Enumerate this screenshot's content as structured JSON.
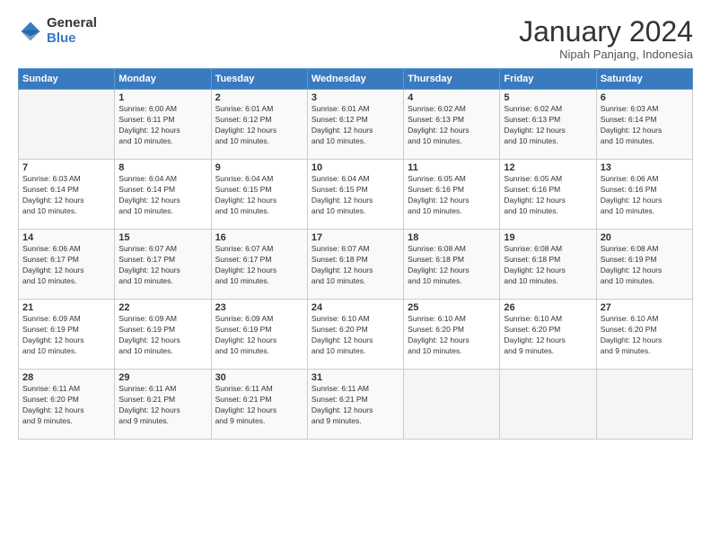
{
  "logo": {
    "general": "General",
    "blue": "Blue"
  },
  "header": {
    "month_year": "January 2024",
    "location": "Nipah Panjang, Indonesia"
  },
  "weekdays": [
    "Sunday",
    "Monday",
    "Tuesday",
    "Wednesday",
    "Thursday",
    "Friday",
    "Saturday"
  ],
  "weeks": [
    [
      {
        "day": "",
        "info": ""
      },
      {
        "day": "1",
        "info": "Sunrise: 6:00 AM\nSunset: 6:11 PM\nDaylight: 12 hours\nand 10 minutes."
      },
      {
        "day": "2",
        "info": "Sunrise: 6:01 AM\nSunset: 6:12 PM\nDaylight: 12 hours\nand 10 minutes."
      },
      {
        "day": "3",
        "info": "Sunrise: 6:01 AM\nSunset: 6:12 PM\nDaylight: 12 hours\nand 10 minutes."
      },
      {
        "day": "4",
        "info": "Sunrise: 6:02 AM\nSunset: 6:13 PM\nDaylight: 12 hours\nand 10 minutes."
      },
      {
        "day": "5",
        "info": "Sunrise: 6:02 AM\nSunset: 6:13 PM\nDaylight: 12 hours\nand 10 minutes."
      },
      {
        "day": "6",
        "info": "Sunrise: 6:03 AM\nSunset: 6:14 PM\nDaylight: 12 hours\nand 10 minutes."
      }
    ],
    [
      {
        "day": "7",
        "info": "Sunrise: 6:03 AM\nSunset: 6:14 PM\nDaylight: 12 hours\nand 10 minutes."
      },
      {
        "day": "8",
        "info": "Sunrise: 6:04 AM\nSunset: 6:14 PM\nDaylight: 12 hours\nand 10 minutes."
      },
      {
        "day": "9",
        "info": "Sunrise: 6:04 AM\nSunset: 6:15 PM\nDaylight: 12 hours\nand 10 minutes."
      },
      {
        "day": "10",
        "info": "Sunrise: 6:04 AM\nSunset: 6:15 PM\nDaylight: 12 hours\nand 10 minutes."
      },
      {
        "day": "11",
        "info": "Sunrise: 6:05 AM\nSunset: 6:16 PM\nDaylight: 12 hours\nand 10 minutes."
      },
      {
        "day": "12",
        "info": "Sunrise: 6:05 AM\nSunset: 6:16 PM\nDaylight: 12 hours\nand 10 minutes."
      },
      {
        "day": "13",
        "info": "Sunrise: 6:06 AM\nSunset: 6:16 PM\nDaylight: 12 hours\nand 10 minutes."
      }
    ],
    [
      {
        "day": "14",
        "info": "Sunrise: 6:06 AM\nSunset: 6:17 PM\nDaylight: 12 hours\nand 10 minutes."
      },
      {
        "day": "15",
        "info": "Sunrise: 6:07 AM\nSunset: 6:17 PM\nDaylight: 12 hours\nand 10 minutes."
      },
      {
        "day": "16",
        "info": "Sunrise: 6:07 AM\nSunset: 6:17 PM\nDaylight: 12 hours\nand 10 minutes."
      },
      {
        "day": "17",
        "info": "Sunrise: 6:07 AM\nSunset: 6:18 PM\nDaylight: 12 hours\nand 10 minutes."
      },
      {
        "day": "18",
        "info": "Sunrise: 6:08 AM\nSunset: 6:18 PM\nDaylight: 12 hours\nand 10 minutes."
      },
      {
        "day": "19",
        "info": "Sunrise: 6:08 AM\nSunset: 6:18 PM\nDaylight: 12 hours\nand 10 minutes."
      },
      {
        "day": "20",
        "info": "Sunrise: 6:08 AM\nSunset: 6:19 PM\nDaylight: 12 hours\nand 10 minutes."
      }
    ],
    [
      {
        "day": "21",
        "info": "Sunrise: 6:09 AM\nSunset: 6:19 PM\nDaylight: 12 hours\nand 10 minutes."
      },
      {
        "day": "22",
        "info": "Sunrise: 6:09 AM\nSunset: 6:19 PM\nDaylight: 12 hours\nand 10 minutes."
      },
      {
        "day": "23",
        "info": "Sunrise: 6:09 AM\nSunset: 6:19 PM\nDaylight: 12 hours\nand 10 minutes."
      },
      {
        "day": "24",
        "info": "Sunrise: 6:10 AM\nSunset: 6:20 PM\nDaylight: 12 hours\nand 10 minutes."
      },
      {
        "day": "25",
        "info": "Sunrise: 6:10 AM\nSunset: 6:20 PM\nDaylight: 12 hours\nand 10 minutes."
      },
      {
        "day": "26",
        "info": "Sunrise: 6:10 AM\nSunset: 6:20 PM\nDaylight: 12 hours\nand 9 minutes."
      },
      {
        "day": "27",
        "info": "Sunrise: 6:10 AM\nSunset: 6:20 PM\nDaylight: 12 hours\nand 9 minutes."
      }
    ],
    [
      {
        "day": "28",
        "info": "Sunrise: 6:11 AM\nSunset: 6:20 PM\nDaylight: 12 hours\nand 9 minutes."
      },
      {
        "day": "29",
        "info": "Sunrise: 6:11 AM\nSunset: 6:21 PM\nDaylight: 12 hours\nand 9 minutes."
      },
      {
        "day": "30",
        "info": "Sunrise: 6:11 AM\nSunset: 6:21 PM\nDaylight: 12 hours\nand 9 minutes."
      },
      {
        "day": "31",
        "info": "Sunrise: 6:11 AM\nSunset: 6:21 PM\nDaylight: 12 hours\nand 9 minutes."
      },
      {
        "day": "",
        "info": ""
      },
      {
        "day": "",
        "info": ""
      },
      {
        "day": "",
        "info": ""
      }
    ]
  ]
}
